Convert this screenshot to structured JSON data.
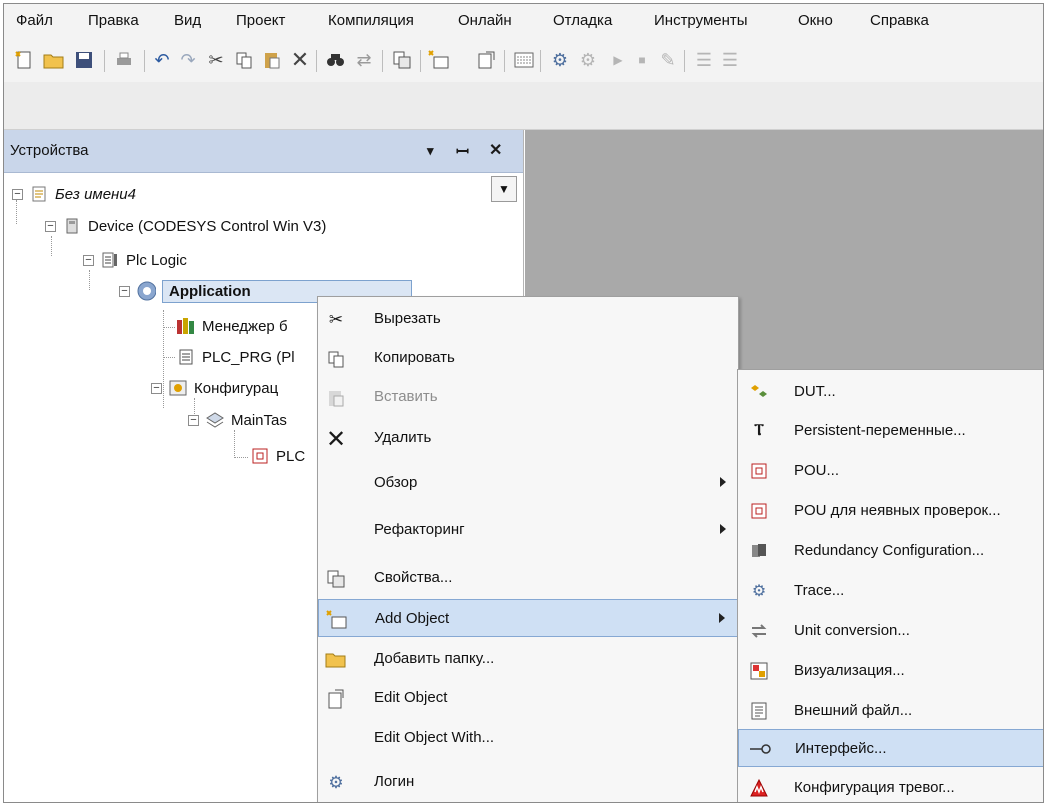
{
  "menubar": [
    "Файл",
    "Правка",
    "Вид",
    "Проект",
    "Компиляция",
    "Онлайн",
    "Отладка",
    "Инструменты",
    "Окно",
    "Справка"
  ],
  "toolbar_icons": [
    "new-file-icon",
    "open-folder-icon",
    "save-icon",
    "print-icon",
    "undo-icon",
    "redo-icon",
    "cut-icon",
    "copy-icon",
    "paste-icon",
    "delete-icon",
    "find-icon",
    "replace-icon",
    "properties-icon",
    "add-object-icon",
    "edit-object-icon",
    "device-icon",
    "login-icon",
    "logout-icon",
    "start-icon",
    "stop-icon",
    "tools-icon",
    "comment-icon",
    "uncomment-icon"
  ],
  "panel": {
    "title": "Устройства",
    "buttons": [
      "▾",
      "ꟷ",
      "✕"
    ],
    "tree": [
      {
        "label": "Без имени4",
        "icon": "project-icon"
      },
      {
        "label": "Device (CODESYS Control Win V3)",
        "icon": "device-icon"
      },
      {
        "label": "Plc Logic",
        "icon": "plc-logic-icon"
      },
      {
        "label": "Application",
        "icon": "application-icon"
      },
      {
        "label": "Менеджер б",
        "icon": "library-manager-icon"
      },
      {
        "label": "PLC_PRG (Pl",
        "icon": "program-icon"
      },
      {
        "label": "Конфигурац",
        "icon": "task-config-icon"
      },
      {
        "label": "MainTas",
        "icon": "task-icon"
      },
      {
        "label": "PLC",
        "icon": "pou-icon"
      }
    ]
  },
  "context_menu": [
    {
      "label": "Вырезать",
      "icon": "cut-icon",
      "disabled": false
    },
    {
      "label": "Копировать",
      "icon": "copy-icon",
      "disabled": false
    },
    {
      "label": "Вставить",
      "icon": "paste-icon",
      "disabled": true
    },
    {
      "label": "Удалить",
      "icon": "delete-icon",
      "disabled": false
    },
    {
      "label": "Обзор",
      "icon": "",
      "submenu": true
    },
    {
      "label": "Рефакторинг",
      "icon": "",
      "submenu": true
    },
    {
      "label": "Свойства...",
      "icon": "properties-icon"
    },
    {
      "label": "Add Object",
      "icon": "add-object-icon",
      "submenu": true,
      "highlighted": true
    },
    {
      "label": "Добавить папку...",
      "icon": "folder-icon"
    },
    {
      "label": "Edit Object",
      "icon": "edit-object-icon"
    },
    {
      "label": "Edit Object With...",
      "icon": ""
    },
    {
      "label": "Логин",
      "icon": "login-icon"
    }
  ],
  "submenu": [
    {
      "label": "DUT...",
      "icon": "dut-icon"
    },
    {
      "label": "Persistent-переменные...",
      "icon": "persistent-vars-icon"
    },
    {
      "label": "POU...",
      "icon": "pou-icon"
    },
    {
      "label": "POU для неявных проверок...",
      "icon": "pou-checks-icon"
    },
    {
      "label": "Redundancy Configuration...",
      "icon": "redundancy-icon"
    },
    {
      "label": "Trace...",
      "icon": "trace-icon"
    },
    {
      "label": "Unit conversion...",
      "icon": "unit-conversion-icon"
    },
    {
      "label": "Визуализация...",
      "icon": "visualization-icon"
    },
    {
      "label": "Внешний файл...",
      "icon": "external-file-icon"
    },
    {
      "label": "Интерфейс...",
      "icon": "interface-icon",
      "highlighted": true
    },
    {
      "label": "Конфигурация тревог...",
      "icon": "alarm-config-icon"
    }
  ]
}
